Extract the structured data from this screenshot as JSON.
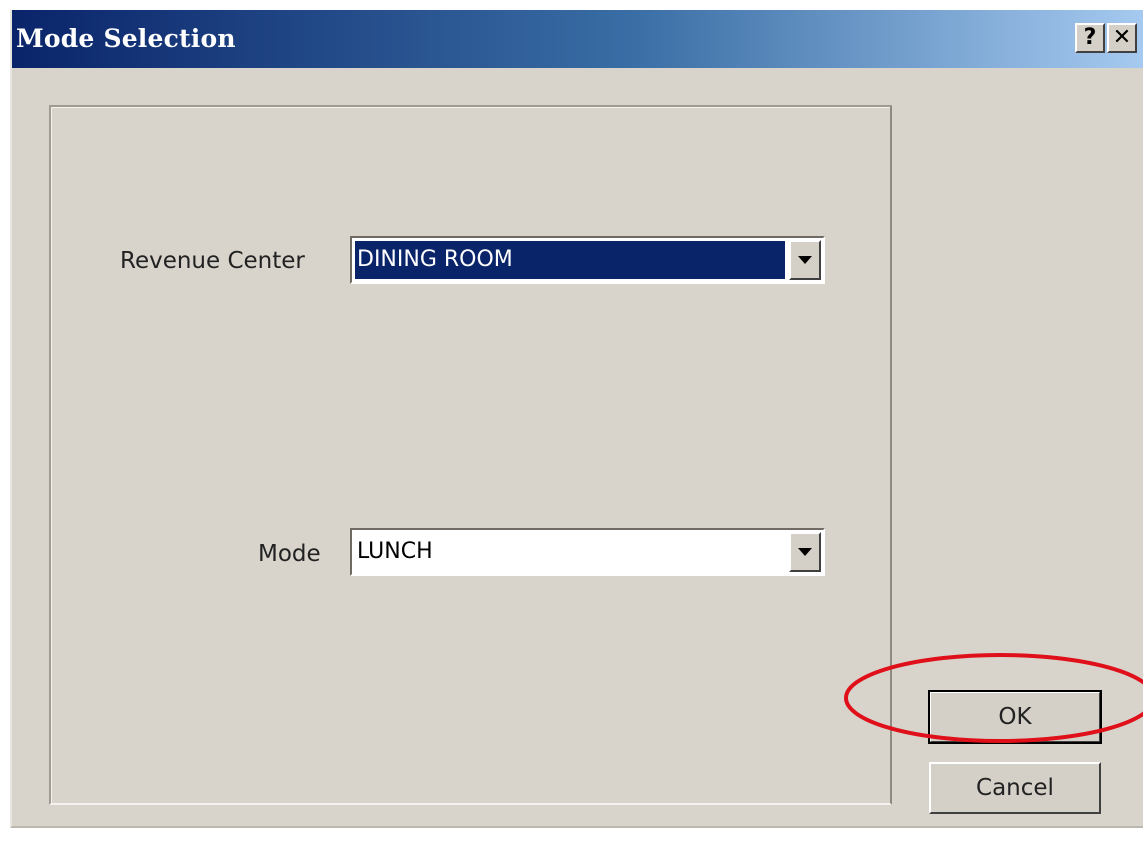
{
  "window": {
    "title": "Mode Selection",
    "help_label": "?",
    "close_label": "✕"
  },
  "form": {
    "revenue_center": {
      "label": "Revenue Center",
      "value": "DINING ROOM"
    },
    "mode": {
      "label": "Mode",
      "value": "LUNCH"
    }
  },
  "buttons": {
    "ok_label": "OK",
    "cancel_label": "Cancel"
  },
  "annotation": {
    "color": "#e0101a",
    "target": "OK button"
  },
  "colors": {
    "titlebar_start": "#0a246a",
    "titlebar_end": "#a6caf0",
    "dialog_background": "#d8d4cc",
    "selection": "#0a246a"
  },
  "icons": {
    "help": "help-question-icon",
    "close": "close-x-icon",
    "dropdown": "chevron-down-icon"
  }
}
